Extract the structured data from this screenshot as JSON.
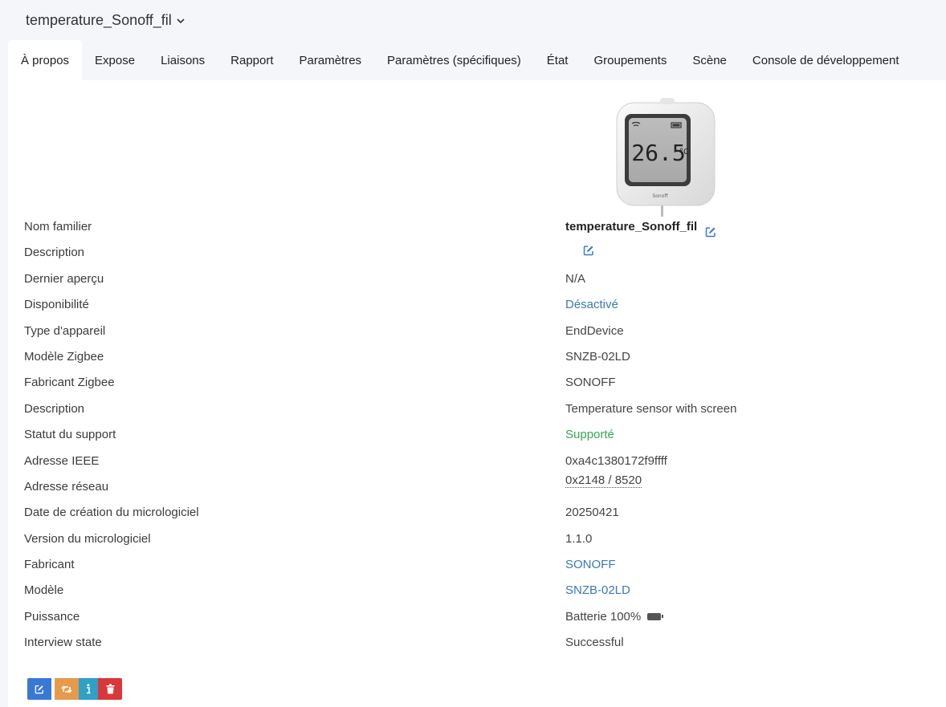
{
  "header": {
    "device_name": "temperature_Sonoff_fil"
  },
  "tabs": [
    {
      "label": "À propos",
      "active": true
    },
    {
      "label": "Expose"
    },
    {
      "label": "Liaisons"
    },
    {
      "label": "Rapport"
    },
    {
      "label": "Paramètres"
    },
    {
      "label": "Paramètres (spécifiques)"
    },
    {
      "label": "État"
    },
    {
      "label": "Groupements"
    },
    {
      "label": "Scène"
    },
    {
      "label": "Console de développement"
    }
  ],
  "device_image": {
    "display_value": "26.5",
    "unit": "°C",
    "brand_mark": "Sonoff"
  },
  "details": {
    "friendly_name": {
      "label": "Nom familier",
      "value": "temperature_Sonoff_fil"
    },
    "description_user": {
      "label": "Description",
      "value": ""
    },
    "last_seen": {
      "label": "Dernier aperçu",
      "value": "N/A"
    },
    "availability": {
      "label": "Disponibilité",
      "value": "Désactivé"
    },
    "device_type": {
      "label": "Type d'appareil",
      "value": "EndDevice"
    },
    "zigbee_model": {
      "label": "Modèle Zigbee",
      "value": "SNZB-02LD"
    },
    "zigbee_manufacturer": {
      "label": "Fabricant Zigbee",
      "value": "SONOFF"
    },
    "description": {
      "label": "Description",
      "value": "Temperature sensor with screen"
    },
    "support_status": {
      "label": "Statut du support",
      "value": "Supporté"
    },
    "ieee_address": {
      "label": "Adresse IEEE",
      "value": "0xa4c1380172f9ffff"
    },
    "network_address": {
      "label": "Adresse réseau",
      "value": "0x2148 / 8520"
    },
    "firmware_date": {
      "label": "Date de création du micrologiciel",
      "value": "20250421"
    },
    "firmware_version": {
      "label": "Version du micrologiciel",
      "value": "1.1.0"
    },
    "manufacturer": {
      "label": "Fabricant",
      "value": "SONOFF"
    },
    "model": {
      "label": "Modèle",
      "value": "SNZB-02LD"
    },
    "power": {
      "label": "Puissance",
      "value": "Batterie 100%"
    },
    "interview_state": {
      "label": "Interview state",
      "value": "Successful"
    }
  },
  "colors": {
    "link": "#3a78b6",
    "success": "#35a853",
    "btn_edit": "#3a78d8",
    "btn_reconfigure": "#e69a4c",
    "btn_interview": "#2fa0c8",
    "btn_delete": "#d9383a"
  },
  "icons": {
    "edit": "edit-icon",
    "battery": "battery-icon",
    "reconfigure": "retweet-icon",
    "info": "info-icon",
    "delete": "trash-icon",
    "dropdown": "chevron-down-icon"
  }
}
